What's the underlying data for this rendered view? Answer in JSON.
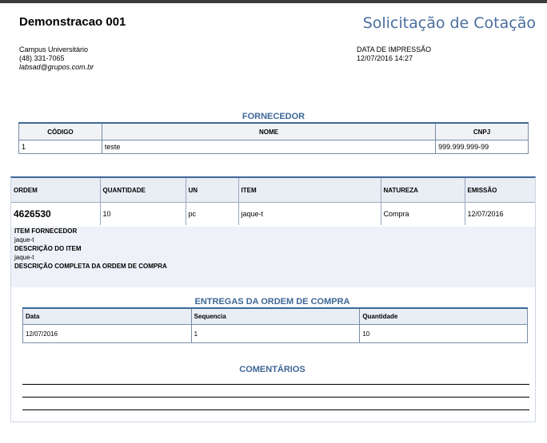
{
  "header": {
    "company": "Demonstracao 001",
    "document_title": "Solicitação de Cotação",
    "address_line": "Campus Universitário",
    "phone": "(48) 331-7065",
    "email": "labsad@grupos.com.br",
    "print_label": "DATA DE IMPRESSÃO",
    "print_date": "12/07/2016 14:27"
  },
  "supplier": {
    "title": "FORNECEDOR",
    "headers": [
      "CÓDIGO",
      "NOME",
      "CNPJ"
    ],
    "row": [
      "1",
      "teste",
      "999.999.999-99"
    ]
  },
  "order": {
    "headers": [
      "ORDEM",
      "QUANTIDADE",
      "UN",
      "ITEM",
      "NATUREZA",
      "EMISSÃO"
    ],
    "row": [
      "4626530",
      "10",
      "pc",
      "jaque-t",
      "Compra",
      "12/07/2016"
    ],
    "supplier_item_label": "ITEM FORNECEDOR",
    "supplier_item_value": "jaque-t",
    "item_desc_label": "DESCRIÇÃO DO ITEM",
    "item_desc_value": "jaque-t",
    "full_desc_label": "DESCRIÇÃO COMPLETA DA ORDEM DE COMPRA"
  },
  "deliveries": {
    "title": "ENTREGAS DA ORDEM DE COMPRA",
    "headers": [
      "Data",
      "Sequencia",
      "Quantidade"
    ],
    "row": [
      "12/07/2016",
      "1",
      "10"
    ]
  },
  "comments": {
    "title": "COMENTÁRIOS"
  }
}
